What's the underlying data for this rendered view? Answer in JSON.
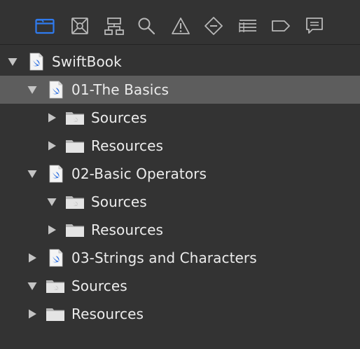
{
  "toolbar": {
    "buttons": [
      {
        "icon": "folder-icon",
        "selected": true
      },
      {
        "icon": "source-control-icon",
        "selected": false
      },
      {
        "icon": "hierarchy-icon",
        "selected": false
      },
      {
        "icon": "search-icon",
        "selected": false
      },
      {
        "icon": "warning-icon",
        "selected": false
      },
      {
        "icon": "test-diamond-icon",
        "selected": false
      },
      {
        "icon": "debug-list-icon",
        "selected": false
      },
      {
        "icon": "breakpoint-icon",
        "selected": false
      },
      {
        "icon": "report-bubble-icon",
        "selected": false
      }
    ],
    "accent_color": "#2f7bf0"
  },
  "tree": {
    "selected_color": "#5d5d5d",
    "items": [
      {
        "label": "SwiftBook",
        "kind": "swift-playground",
        "depth": 0,
        "expanded": true
      },
      {
        "label": "01-The Basics",
        "kind": "swift-page",
        "depth": 1,
        "expanded": true,
        "selected": true
      },
      {
        "label": "Sources",
        "kind": "source-folder",
        "depth": 2,
        "expanded": false
      },
      {
        "label": "Resources",
        "kind": "folder",
        "depth": 2,
        "expanded": false
      },
      {
        "label": "02-Basic Operators",
        "kind": "swift-page",
        "depth": 1,
        "expanded": true
      },
      {
        "label": "Sources",
        "kind": "source-folder",
        "depth": 2,
        "expanded": true
      },
      {
        "label": "Resources",
        "kind": "folder",
        "depth": 2,
        "expanded": false
      },
      {
        "label": "03-Strings and Characters",
        "kind": "swift-page",
        "depth": 1,
        "expanded": false
      },
      {
        "label": "Sources",
        "kind": "source-folder",
        "depth": 1,
        "expanded": true
      },
      {
        "label": "Resources",
        "kind": "folder",
        "depth": 1,
        "expanded": false
      }
    ]
  }
}
